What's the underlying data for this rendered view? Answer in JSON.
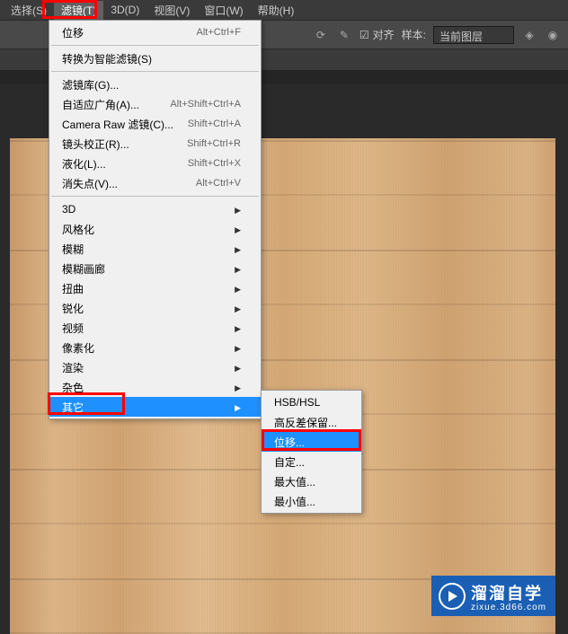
{
  "menubar": {
    "items": [
      {
        "label": "选择(S)"
      },
      {
        "label": "滤镜(T)",
        "active": true
      },
      {
        "label": "3D(D)"
      },
      {
        "label": "视图(V)"
      },
      {
        "label": "窗口(W)"
      },
      {
        "label": "帮助(H)"
      }
    ]
  },
  "toolbar": {
    "alignLabel": "对齐",
    "sampleLabel": "样本:",
    "sampleValue": "当前图层"
  },
  "filterMenu": {
    "recent": {
      "label": "位移",
      "shortcut": "Alt+Ctrl+F"
    },
    "smartFilter": {
      "label": "转换为智能滤镜(S)"
    },
    "group1": [
      {
        "label": "滤镜库(G)...",
        "shortcut": ""
      },
      {
        "label": "自适应广角(A)...",
        "shortcut": "Alt+Shift+Ctrl+A"
      },
      {
        "label": "Camera Raw 滤镜(C)...",
        "shortcut": "Shift+Ctrl+A"
      },
      {
        "label": "镜头校正(R)...",
        "shortcut": "Shift+Ctrl+R"
      },
      {
        "label": "液化(L)...",
        "shortcut": "Shift+Ctrl+X"
      },
      {
        "label": "消失点(V)...",
        "shortcut": "Alt+Ctrl+V"
      }
    ],
    "group2": [
      {
        "label": "3D"
      },
      {
        "label": "风格化"
      },
      {
        "label": "模糊"
      },
      {
        "label": "模糊画廊"
      },
      {
        "label": "扭曲"
      },
      {
        "label": "锐化"
      },
      {
        "label": "视频"
      },
      {
        "label": "像素化"
      },
      {
        "label": "渲染"
      },
      {
        "label": "杂色"
      },
      {
        "label": "其它",
        "highlighted": true
      }
    ]
  },
  "otherSubmenu": {
    "items": [
      {
        "label": "HSB/HSL"
      },
      {
        "label": "高反差保留..."
      },
      {
        "label": "位移...",
        "highlighted": true
      },
      {
        "label": "自定..."
      },
      {
        "label": "最大值..."
      },
      {
        "label": "最小值..."
      }
    ]
  },
  "watermark": {
    "title": "溜溜自学",
    "sub": "zixue.3d66.com"
  }
}
